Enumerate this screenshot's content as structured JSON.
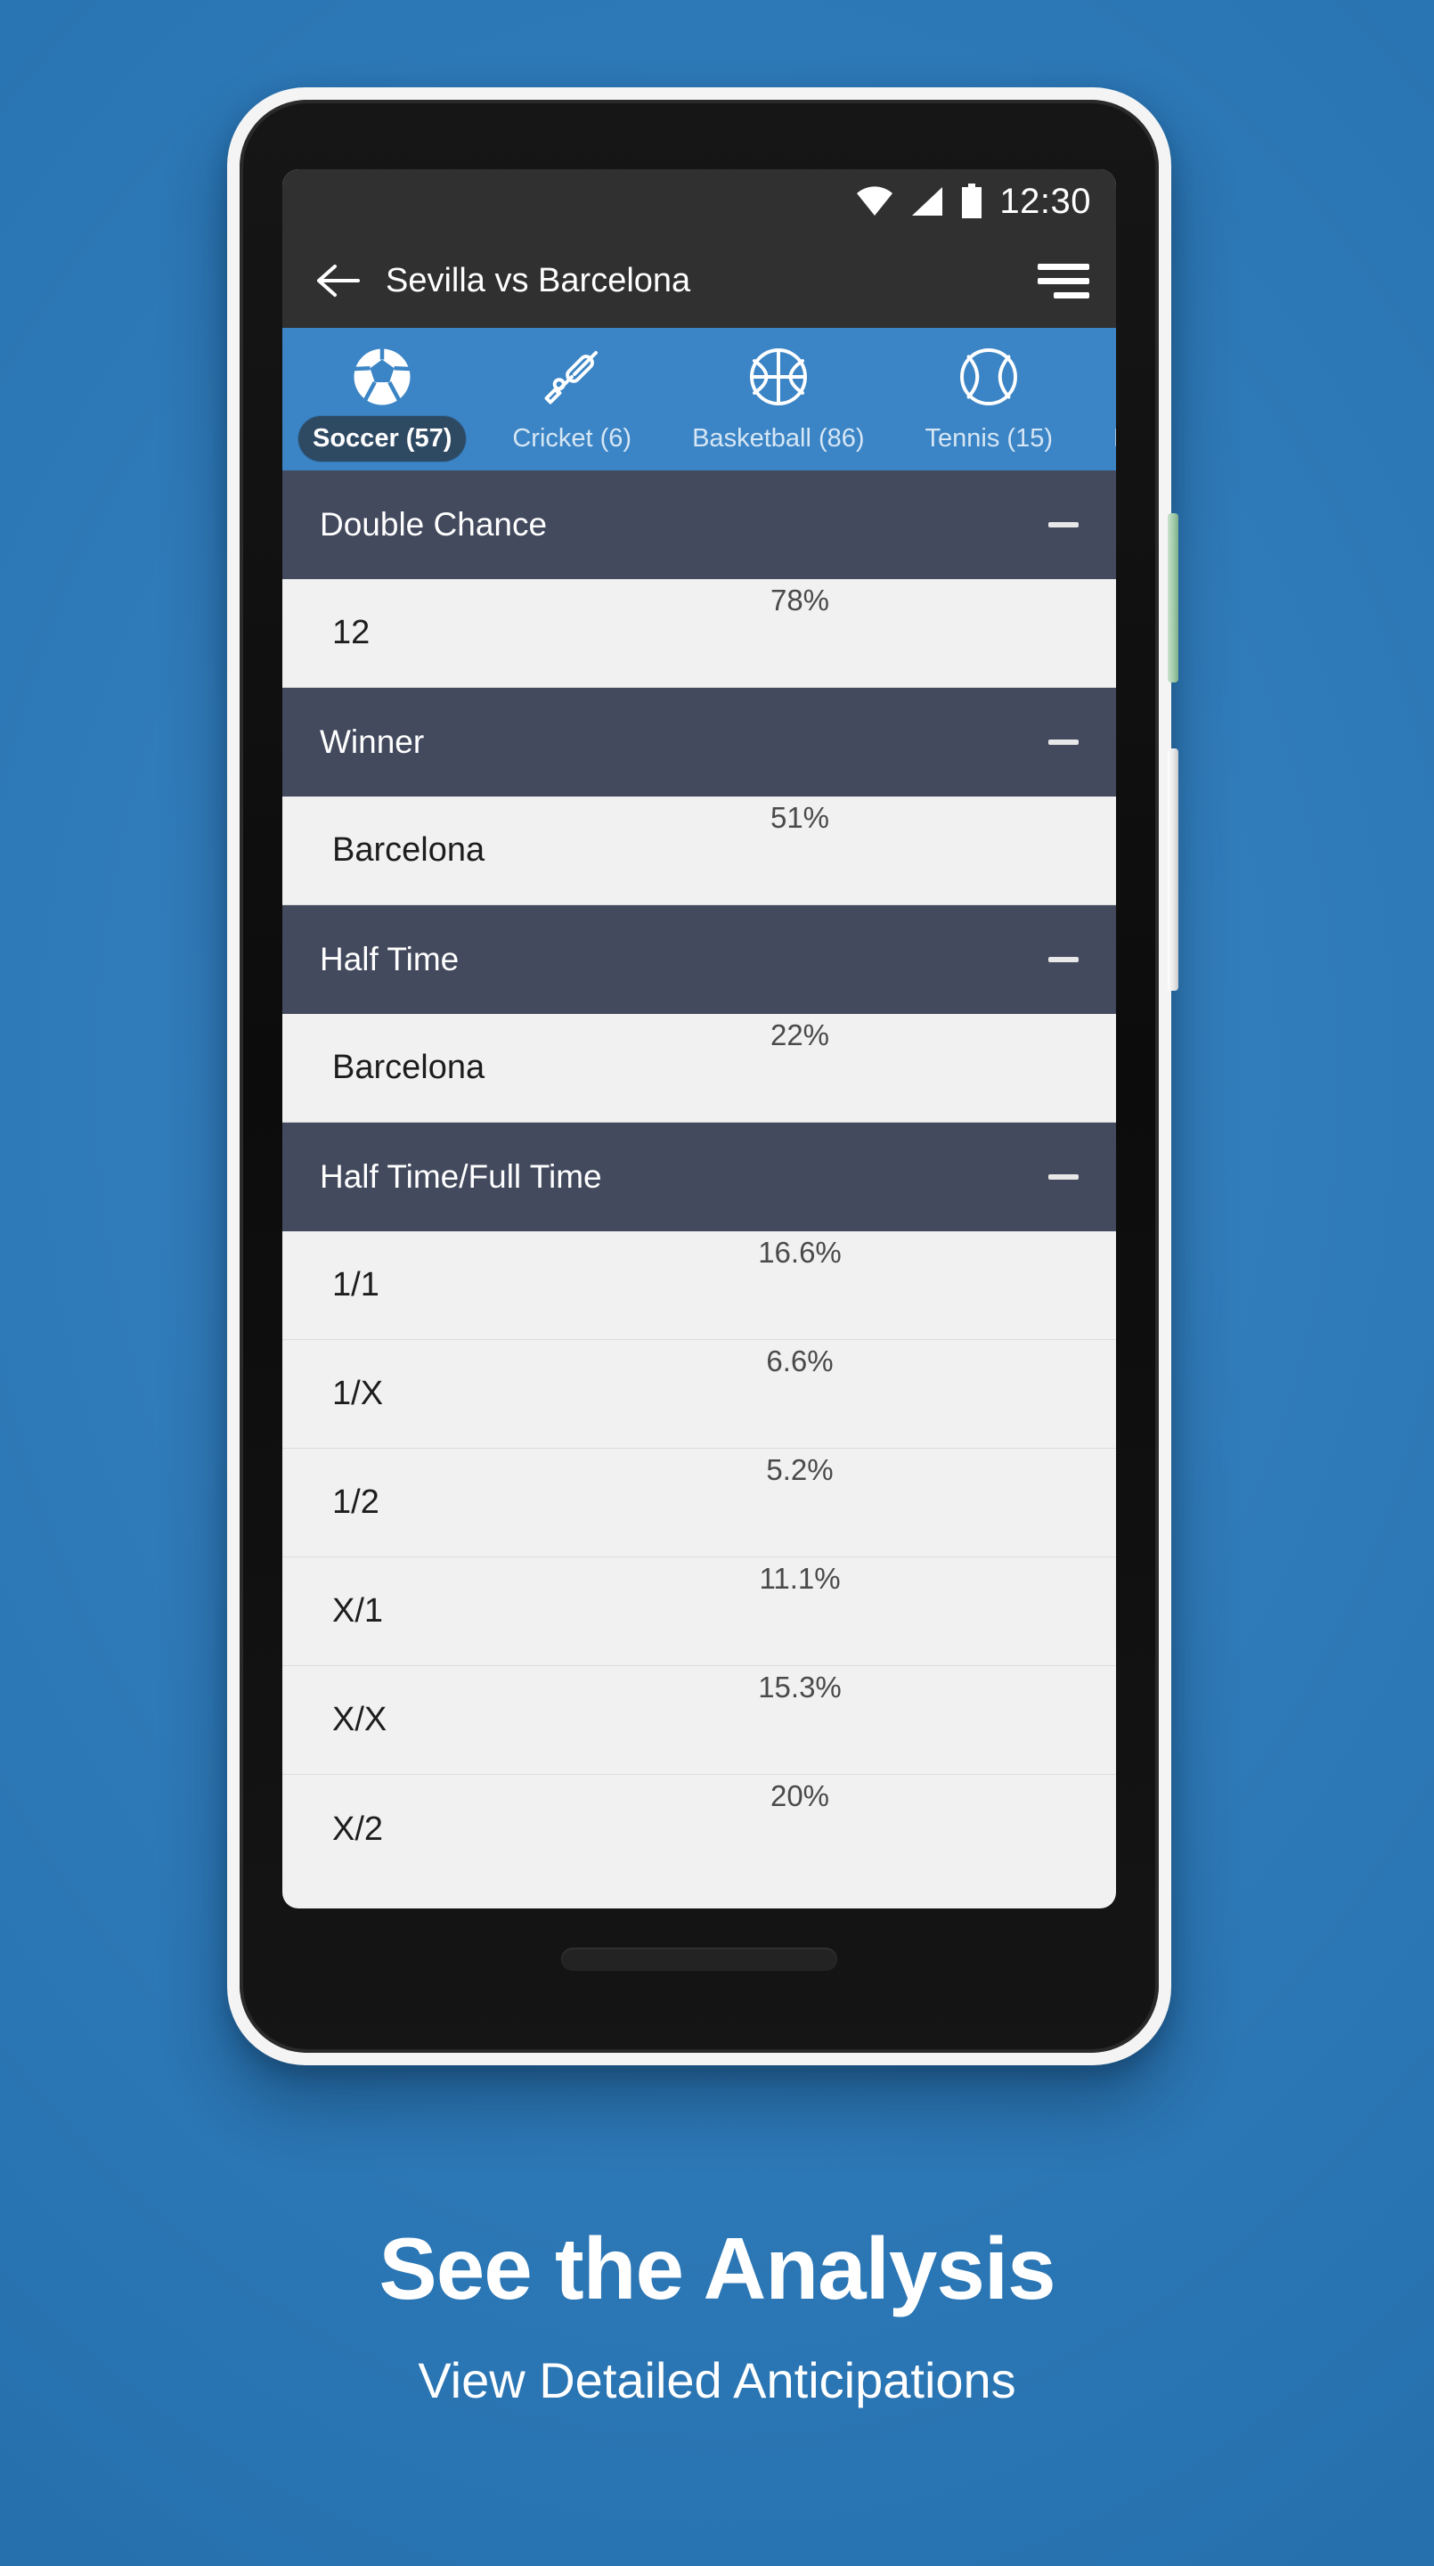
{
  "status_bar": {
    "time": "12:30",
    "icons": [
      "wifi-icon",
      "signal-icon",
      "battery-icon"
    ]
  },
  "app_bar": {
    "back_icon": "back-arrow-icon",
    "title": "Sevilla vs Barcelona",
    "menu_icon": "hamburger-menu-icon"
  },
  "sport_tabs": {
    "active_index": 0,
    "items": [
      {
        "label": "Soccer (57)",
        "icon": "soccer-ball-icon"
      },
      {
        "label": "Cricket (6)",
        "icon": "cricket-bat-icon"
      },
      {
        "label": "Basketball (86)",
        "icon": "basketball-icon"
      },
      {
        "label": "Tennis (15)",
        "icon": "tennis-ball-icon"
      },
      {
        "label": "Horce Racing",
        "icon": "horse-racing-icon"
      }
    ]
  },
  "markets": [
    {
      "title": "Double Chance",
      "collapse_icon": "minus-icon",
      "outcomes": [
        {
          "label": "12",
          "value": "78%",
          "percent": 78,
          "color": "#2ee02e"
        }
      ]
    },
    {
      "title": "Winner",
      "collapse_icon": "minus-icon",
      "outcomes": [
        {
          "label": "Barcelona",
          "value": "51%",
          "percent": 51,
          "color": "#f7983f"
        }
      ]
    },
    {
      "title": "Half Time",
      "collapse_icon": "minus-icon",
      "outcomes": [
        {
          "label": "Barcelona",
          "value": "22%",
          "percent": 22,
          "color": "#fa0505"
        }
      ]
    },
    {
      "title": "Half Time/Full Time",
      "collapse_icon": "minus-icon",
      "outcomes": [
        {
          "label": "1/1",
          "value": "16.6%",
          "percent": 16.6,
          "color": "#fa0505"
        },
        {
          "label": "1/X",
          "value": "6.6%",
          "percent": 6.6,
          "color": "#fa0505"
        },
        {
          "label": "1/2",
          "value": "5.2%",
          "percent": 5.2,
          "color": "#fa0505"
        },
        {
          "label": "X/1",
          "value": "11.1%",
          "percent": 11.1,
          "color": "#fa0505"
        },
        {
          "label": "X/X",
          "value": "15.3%",
          "percent": 15.3,
          "color": "#fa0505"
        },
        {
          "label": "X/2",
          "value": "20%",
          "percent": 20,
          "color": "#fa0505"
        }
      ]
    }
  ],
  "caption": {
    "title": "See the Analysis",
    "subtitle": "View Detailed Anticipations"
  },
  "colors": {
    "background_blue": "#2f7ab8",
    "tab_bar_blue": "#3b85c6",
    "market_header": "#434a5e",
    "app_bar": "#303030",
    "row_background": "#f1f1f1",
    "meter_track": "#c3c3c3"
  }
}
